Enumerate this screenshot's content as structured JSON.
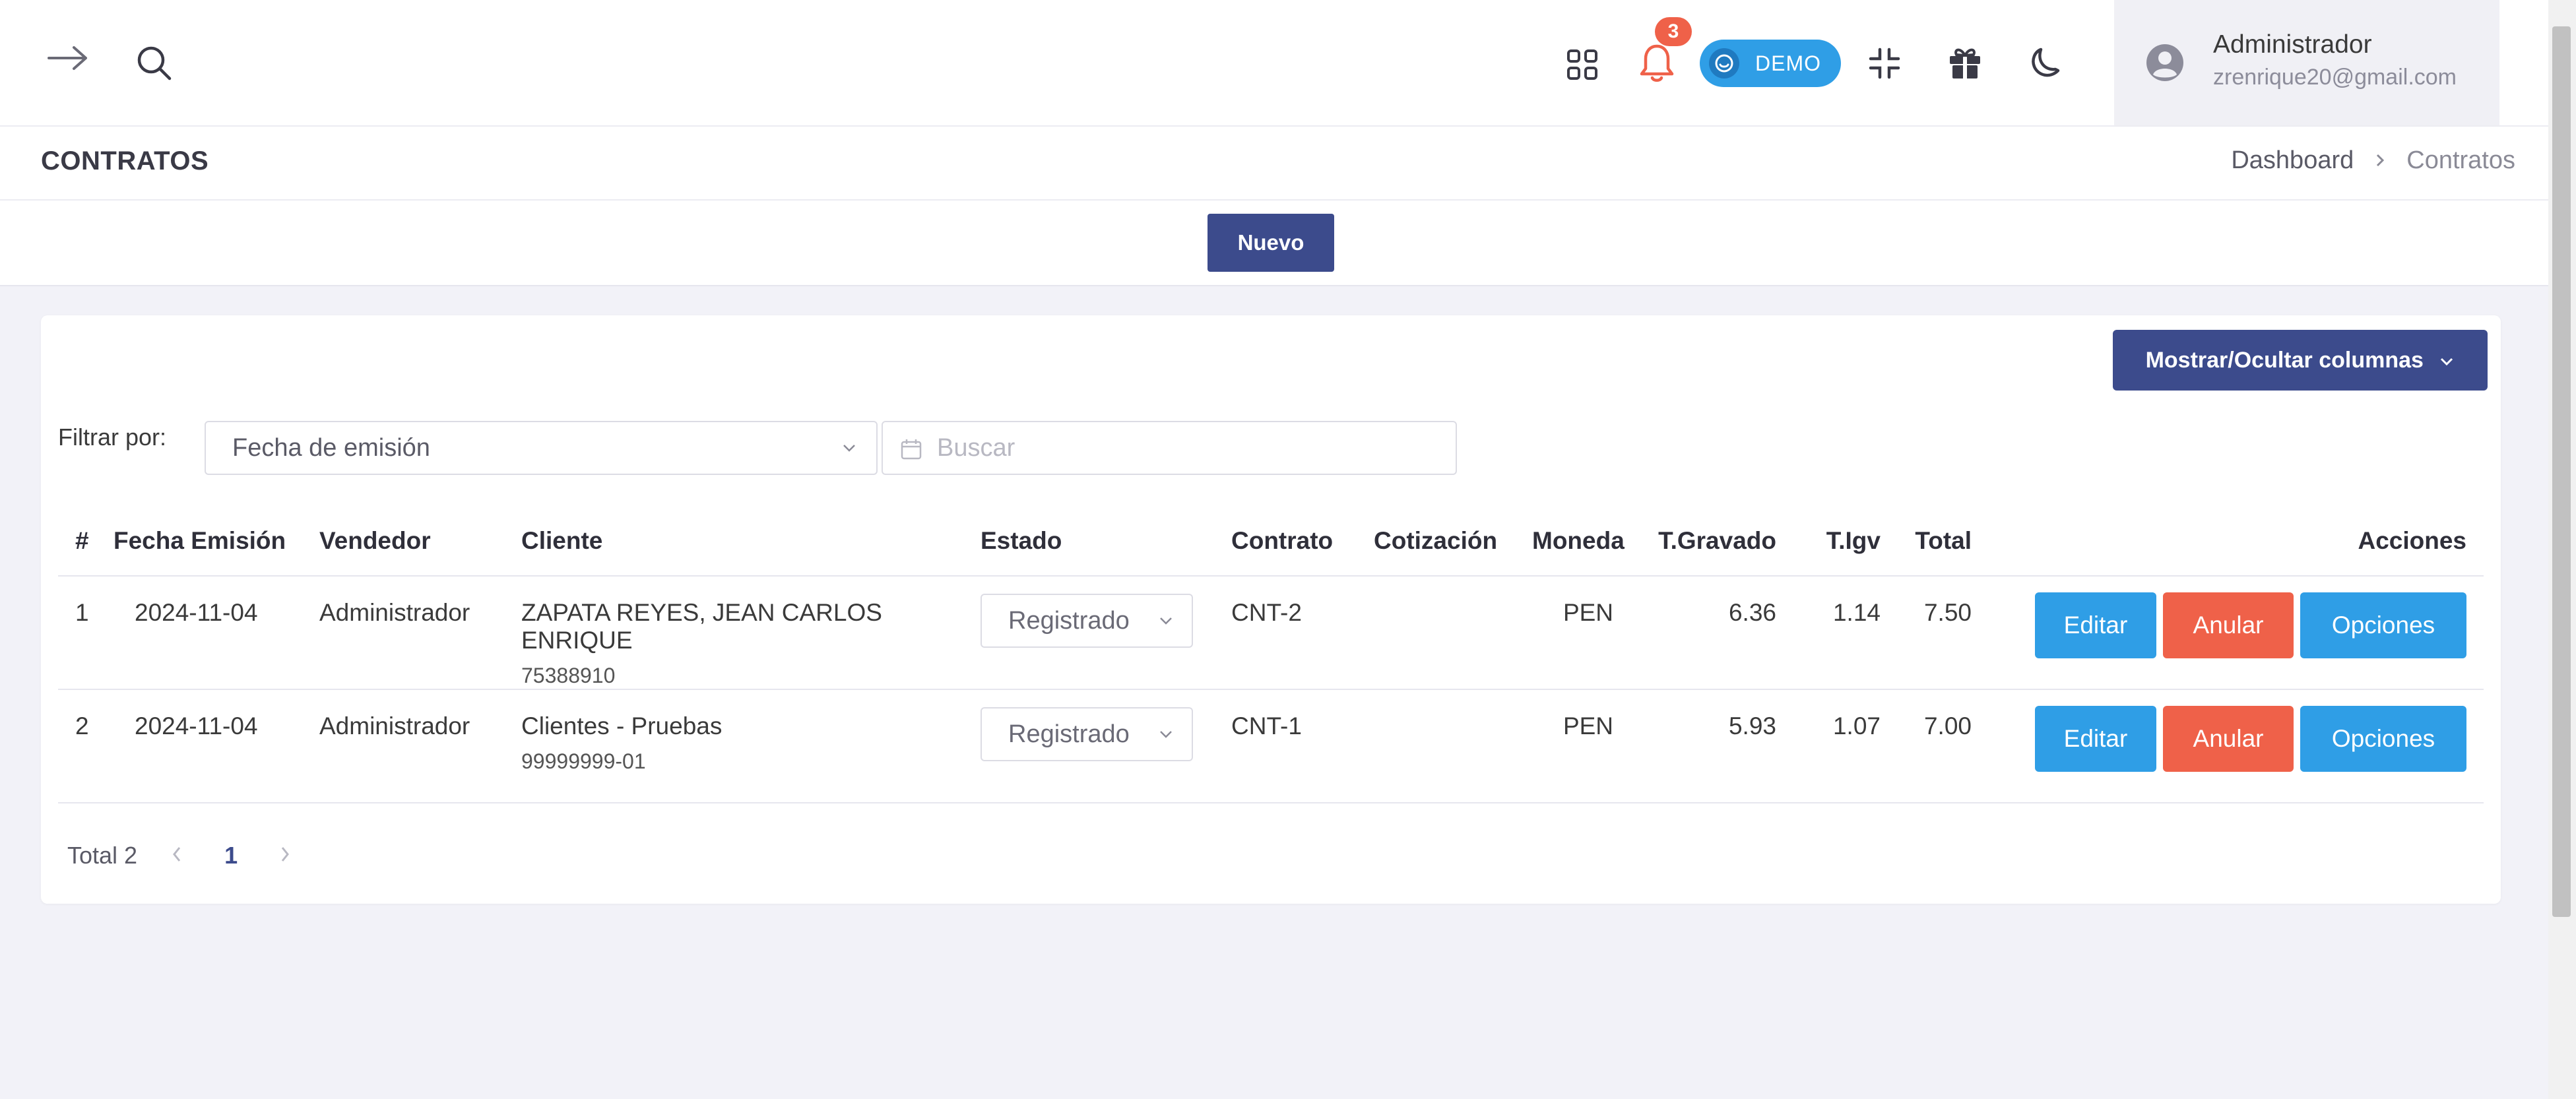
{
  "header": {
    "notifications_count": "3",
    "demo_label": "DEMO",
    "user_name": "Administrador",
    "user_email": "zrenrique20@gmail.com",
    "icons": [
      "arrow-right-icon",
      "search-icon",
      "apps-grid-icon",
      "bell-icon",
      "compress-icon",
      "gift-icon",
      "moon-icon",
      "user-circle-icon"
    ]
  },
  "page": {
    "title": "CONTRATOS",
    "breadcrumb": [
      "Dashboard",
      "Contratos"
    ]
  },
  "actions": {
    "new_label": "Nuevo"
  },
  "card": {
    "columns_button": "Mostrar/Ocultar columnas",
    "filter_label": "Filtrar por:",
    "filter_value": "Fecha de emisión",
    "search_placeholder": "Buscar"
  },
  "table": {
    "headers": [
      "#",
      "Fecha Emisión",
      "Vendedor",
      "Cliente",
      "Estado",
      "Contrato",
      "Cotización",
      "Moneda",
      "T.Gravado",
      "T.Igv",
      "Total",
      "Acciones"
    ],
    "rows": [
      {
        "num": "1",
        "fecha": "2024-11-04",
        "vendedor": "Administrador",
        "cliente": "ZAPATA REYES, JEAN CARLOS ENRIQUE",
        "cliente_doc": "75388910",
        "estado": "Registrado",
        "contrato": "CNT-2",
        "cotizacion": "",
        "moneda": "PEN",
        "gravado": "6.36",
        "igv": "1.14",
        "total": "7.50",
        "btn_edit": "Editar",
        "btn_anular": "Anular",
        "btn_opciones": "Opciones"
      },
      {
        "num": "2",
        "fecha": "2024-11-04",
        "vendedor": "Administrador",
        "cliente": "Clientes - Pruebas",
        "cliente_doc": "99999999-01",
        "estado": "Registrado",
        "contrato": "CNT-1",
        "cotizacion": "",
        "moneda": "PEN",
        "gravado": "5.93",
        "igv": "1.07",
        "total": "7.00",
        "btn_edit": "Editar",
        "btn_anular": "Anular",
        "btn_opciones": "Opciones"
      }
    ]
  },
  "pagination": {
    "total_label": "Total 2",
    "current_page": "1"
  },
  "colors": {
    "primary": "#3c4b8c",
    "info": "#2f9ee6",
    "danger": "#ef6149",
    "background": "#f2f2f8"
  }
}
